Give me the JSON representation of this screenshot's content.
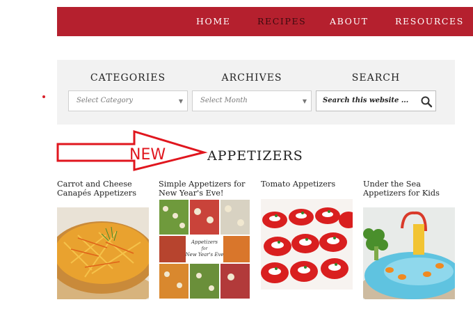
{
  "nav": {
    "items": [
      {
        "label": "HOME",
        "active": false
      },
      {
        "label": "RECIPES",
        "active": true
      },
      {
        "label": "ABOUT",
        "active": false
      },
      {
        "label": "RESOURCES",
        "active": false
      }
    ]
  },
  "filters": {
    "categories_title": "CATEGORIES",
    "categories_value": "Select Category",
    "archives_title": "ARCHIVES",
    "archives_value": "Select Month",
    "search_title": "SEARCH",
    "search_placeholder": "Search this website ..."
  },
  "annotation": {
    "new_label": "NEW"
  },
  "section": {
    "title": "APPETIZERS"
  },
  "cards": [
    {
      "title": "Carrot and Cheese Canapés Appetizers"
    },
    {
      "title": "Simple Appetizers for New Year's Eve!",
      "image_text": "Appetizers for New Year's Eve"
    },
    {
      "title": "Tomato Appetizers"
    },
    {
      "title": "Under the Sea Appetizers for Kids"
    }
  ],
  "colors": {
    "brand": "#b5202e",
    "annotation": "#e0161e",
    "panel": "#f2f2f2"
  }
}
